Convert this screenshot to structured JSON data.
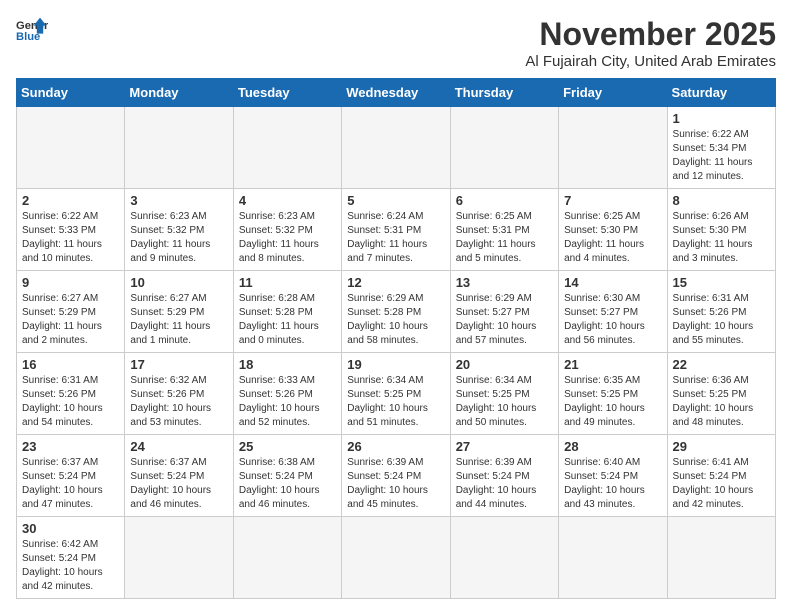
{
  "logo": {
    "text_general": "General",
    "text_blue": "Blue"
  },
  "title": "November 2025",
  "location": "Al Fujairah City, United Arab Emirates",
  "weekdays": [
    "Sunday",
    "Monday",
    "Tuesday",
    "Wednesday",
    "Thursday",
    "Friday",
    "Saturday"
  ],
  "weeks": [
    [
      {
        "day": "",
        "info": ""
      },
      {
        "day": "",
        "info": ""
      },
      {
        "day": "",
        "info": ""
      },
      {
        "day": "",
        "info": ""
      },
      {
        "day": "",
        "info": ""
      },
      {
        "day": "",
        "info": ""
      },
      {
        "day": "1",
        "info": "Sunrise: 6:22 AM\nSunset: 5:34 PM\nDaylight: 11 hours and 12 minutes."
      }
    ],
    [
      {
        "day": "2",
        "info": "Sunrise: 6:22 AM\nSunset: 5:33 PM\nDaylight: 11 hours and 10 minutes."
      },
      {
        "day": "3",
        "info": "Sunrise: 6:23 AM\nSunset: 5:32 PM\nDaylight: 11 hours and 9 minutes."
      },
      {
        "day": "4",
        "info": "Sunrise: 6:23 AM\nSunset: 5:32 PM\nDaylight: 11 hours and 8 minutes."
      },
      {
        "day": "5",
        "info": "Sunrise: 6:24 AM\nSunset: 5:31 PM\nDaylight: 11 hours and 7 minutes."
      },
      {
        "day": "6",
        "info": "Sunrise: 6:25 AM\nSunset: 5:31 PM\nDaylight: 11 hours and 5 minutes."
      },
      {
        "day": "7",
        "info": "Sunrise: 6:25 AM\nSunset: 5:30 PM\nDaylight: 11 hours and 4 minutes."
      },
      {
        "day": "8",
        "info": "Sunrise: 6:26 AM\nSunset: 5:30 PM\nDaylight: 11 hours and 3 minutes."
      }
    ],
    [
      {
        "day": "9",
        "info": "Sunrise: 6:27 AM\nSunset: 5:29 PM\nDaylight: 11 hours and 2 minutes."
      },
      {
        "day": "10",
        "info": "Sunrise: 6:27 AM\nSunset: 5:29 PM\nDaylight: 11 hours and 1 minute."
      },
      {
        "day": "11",
        "info": "Sunrise: 6:28 AM\nSunset: 5:28 PM\nDaylight: 11 hours and 0 minutes."
      },
      {
        "day": "12",
        "info": "Sunrise: 6:29 AM\nSunset: 5:28 PM\nDaylight: 10 hours and 58 minutes."
      },
      {
        "day": "13",
        "info": "Sunrise: 6:29 AM\nSunset: 5:27 PM\nDaylight: 10 hours and 57 minutes."
      },
      {
        "day": "14",
        "info": "Sunrise: 6:30 AM\nSunset: 5:27 PM\nDaylight: 10 hours and 56 minutes."
      },
      {
        "day": "15",
        "info": "Sunrise: 6:31 AM\nSunset: 5:26 PM\nDaylight: 10 hours and 55 minutes."
      }
    ],
    [
      {
        "day": "16",
        "info": "Sunrise: 6:31 AM\nSunset: 5:26 PM\nDaylight: 10 hours and 54 minutes."
      },
      {
        "day": "17",
        "info": "Sunrise: 6:32 AM\nSunset: 5:26 PM\nDaylight: 10 hours and 53 minutes."
      },
      {
        "day": "18",
        "info": "Sunrise: 6:33 AM\nSunset: 5:26 PM\nDaylight: 10 hours and 52 minutes."
      },
      {
        "day": "19",
        "info": "Sunrise: 6:34 AM\nSunset: 5:25 PM\nDaylight: 10 hours and 51 minutes."
      },
      {
        "day": "20",
        "info": "Sunrise: 6:34 AM\nSunset: 5:25 PM\nDaylight: 10 hours and 50 minutes."
      },
      {
        "day": "21",
        "info": "Sunrise: 6:35 AM\nSunset: 5:25 PM\nDaylight: 10 hours and 49 minutes."
      },
      {
        "day": "22",
        "info": "Sunrise: 6:36 AM\nSunset: 5:25 PM\nDaylight: 10 hours and 48 minutes."
      }
    ],
    [
      {
        "day": "23",
        "info": "Sunrise: 6:37 AM\nSunset: 5:24 PM\nDaylight: 10 hours and 47 minutes."
      },
      {
        "day": "24",
        "info": "Sunrise: 6:37 AM\nSunset: 5:24 PM\nDaylight: 10 hours and 46 minutes."
      },
      {
        "day": "25",
        "info": "Sunrise: 6:38 AM\nSunset: 5:24 PM\nDaylight: 10 hours and 46 minutes."
      },
      {
        "day": "26",
        "info": "Sunrise: 6:39 AM\nSunset: 5:24 PM\nDaylight: 10 hours and 45 minutes."
      },
      {
        "day": "27",
        "info": "Sunrise: 6:39 AM\nSunset: 5:24 PM\nDaylight: 10 hours and 44 minutes."
      },
      {
        "day": "28",
        "info": "Sunrise: 6:40 AM\nSunset: 5:24 PM\nDaylight: 10 hours and 43 minutes."
      },
      {
        "day": "29",
        "info": "Sunrise: 6:41 AM\nSunset: 5:24 PM\nDaylight: 10 hours and 42 minutes."
      }
    ],
    [
      {
        "day": "30",
        "info": "Sunrise: 6:42 AM\nSunset: 5:24 PM\nDaylight: 10 hours and 42 minutes."
      },
      {
        "day": "",
        "info": ""
      },
      {
        "day": "",
        "info": ""
      },
      {
        "day": "",
        "info": ""
      },
      {
        "day": "",
        "info": ""
      },
      {
        "day": "",
        "info": ""
      },
      {
        "day": "",
        "info": ""
      }
    ]
  ]
}
